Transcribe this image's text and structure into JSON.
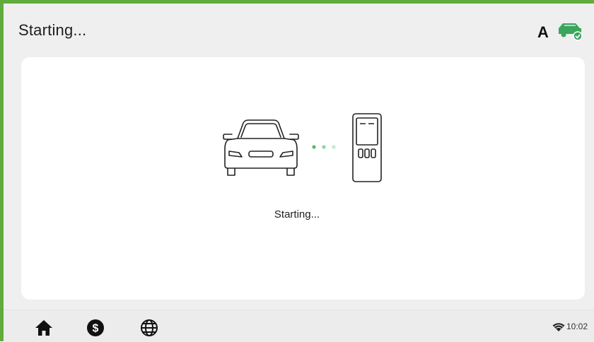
{
  "header": {
    "title": "Starting...",
    "mode_letter": "A",
    "status_icon": "ev-charger-connected-icon",
    "accent_color": "#5fab3b"
  },
  "main": {
    "illustration": {
      "left_icon": "car-icon",
      "right_icon": "charging-station-icon",
      "progress_dots": 3,
      "charger_label": "000"
    },
    "status_text": "Starting..."
  },
  "bottom_nav": {
    "items": [
      {
        "name": "home",
        "icon": "home-icon"
      },
      {
        "name": "pricing",
        "icon": "dollar-icon"
      },
      {
        "name": "language",
        "icon": "globe-icon"
      }
    ]
  },
  "status_bar": {
    "wifi_icon": "wifi-icon",
    "time": "10:02"
  }
}
